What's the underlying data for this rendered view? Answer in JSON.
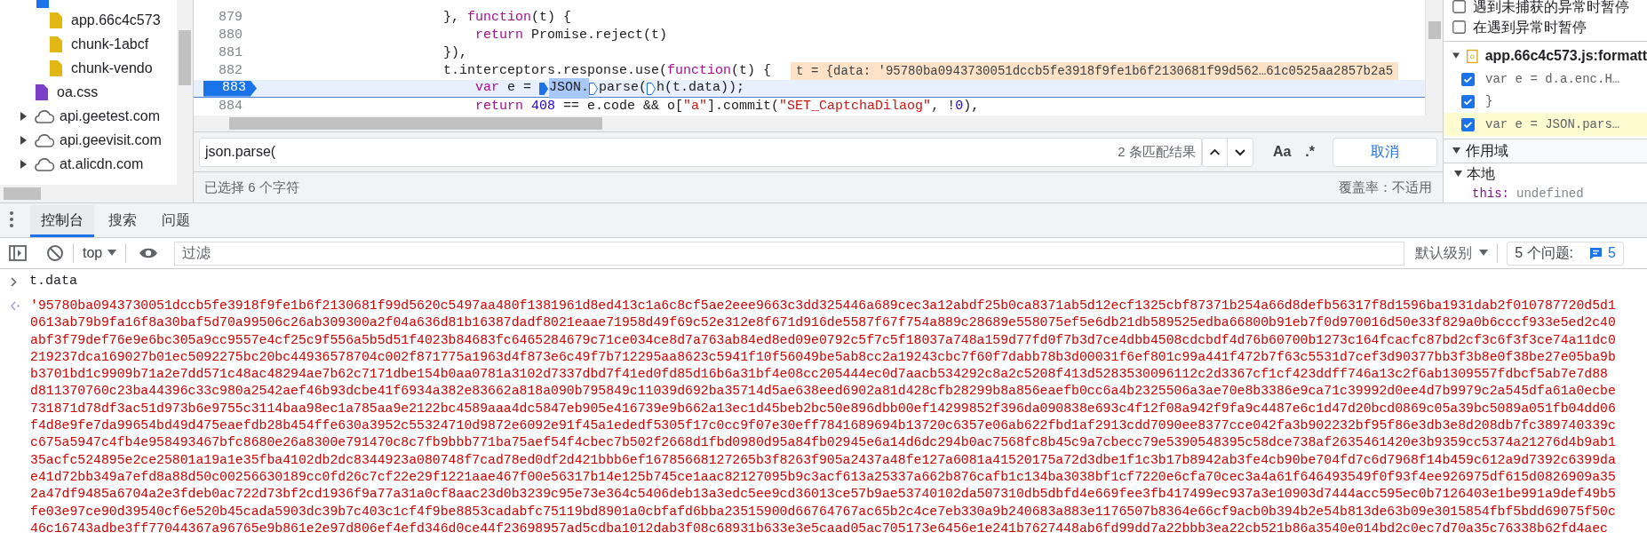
{
  "sources": {
    "nested_items": [
      {
        "kind": "folder",
        "children": [
          {
            "kind": "script",
            "label": "app.66c4c573"
          },
          {
            "kind": "script",
            "label": "chunk-1abcf"
          },
          {
            "kind": "script",
            "label": "chunk-vendo"
          }
        ]
      },
      {
        "kind": "stylesheet",
        "label": "oa.css"
      }
    ],
    "domains": [
      {
        "label": "api.geetest.com",
        "expanded": false
      },
      {
        "label": "api.geevisit.com",
        "expanded": false
      },
      {
        "label": "at.alicdn.com",
        "expanded": false
      }
    ]
  },
  "editor": {
    "lines": [
      {
        "number": "879",
        "paused": false,
        "tokens": [
          {
            "kind": "plain",
            "text": "}, "
          },
          {
            "kind": "keyword",
            "text": "function"
          },
          {
            "kind": "plain",
            "text": "(t) {"
          }
        ]
      },
      {
        "number": "880",
        "paused": false,
        "indent": true,
        "tokens": [
          {
            "kind": "keyword",
            "text": "return"
          },
          {
            "kind": "plain",
            "text": " Promise.reject(t)"
          }
        ]
      },
      {
        "number": "881",
        "paused": false,
        "tokens": [
          {
            "kind": "plain",
            "text": "}),"
          }
        ]
      },
      {
        "number": "882",
        "paused": false,
        "tokens": [
          {
            "kind": "plain",
            "text": "t.interceptors.response.use("
          },
          {
            "kind": "keyword",
            "text": "function"
          },
          {
            "kind": "plain",
            "text": "(t) {"
          }
        ],
        "inline_value": "t = {data: '95780ba0943730051dccb5fe3918f9fe1b6f2130681f99d562…61c0525aa2857b2a5"
      },
      {
        "number": "883",
        "paused": true,
        "indent": true,
        "tokens": [
          {
            "kind": "keyword",
            "text": "var"
          },
          {
            "kind": "plain",
            "text": " e = "
          },
          {
            "kind": "marker",
            "active": true
          },
          {
            "kind": "selected",
            "text": "JSON."
          },
          {
            "kind": "marker",
            "active": false
          },
          {
            "kind": "plain",
            "text": "parse("
          },
          {
            "kind": "marker",
            "active": false
          },
          {
            "kind": "plain",
            "text": "h(t.data));"
          }
        ]
      },
      {
        "number": "884",
        "paused": false,
        "indent": true,
        "tokens": [
          {
            "kind": "keyword",
            "text": "return"
          },
          {
            "kind": "number",
            "text": " 408"
          },
          {
            "kind": "plain",
            "text": " == e.code && o["
          },
          {
            "kind": "string",
            "text": "\"a\""
          },
          {
            "kind": "plain",
            "text": "].commit("
          },
          {
            "kind": "string",
            "text": "\"SET_CaptchaDilaog\""
          },
          {
            "kind": "plain",
            "text": ", !"
          },
          {
            "kind": "number",
            "text": "0"
          },
          {
            "kind": "plain",
            "text": "),"
          }
        ]
      }
    ]
  },
  "search": {
    "value": "json.parse(",
    "match_count": "2 条匹配结果",
    "case_button": "Aa",
    "regex_button": ".*",
    "cancel_button": "取消"
  },
  "status": {
    "selection": "已选择 6 个字符",
    "coverage": "覆盖率：不适用"
  },
  "debugger": {
    "pause_options": [
      {
        "label": "遇到未捕获的异常时暂停",
        "checked": false
      },
      {
        "label": "在遇到异常时暂停",
        "checked": false
      }
    ],
    "breakpoint_file": "app.66c4c573.js:formatt",
    "breakpoints": [
      {
        "label": "var e = d.a.enc.H…",
        "checked": true,
        "selected": false
      },
      {
        "label": "}",
        "checked": true,
        "selected": false
      },
      {
        "label": "var e = JSON.pars…",
        "checked": true,
        "selected": true
      }
    ],
    "scope": {
      "title": "作用域",
      "expanded": true,
      "sections": [
        {
          "title": "本地",
          "expanded": true,
          "vars": [
            {
              "name": "this:",
              "value": "undefined"
            }
          ]
        }
      ]
    }
  },
  "drawer": {
    "tabs": [
      {
        "label": "控制台",
        "selected": true
      },
      {
        "label": "搜索",
        "selected": false
      },
      {
        "label": "问题",
        "selected": false
      }
    ]
  },
  "console_toolbar": {
    "context": "top",
    "filter_placeholder": "过滤",
    "level": "默认级别",
    "issues_label": "5 个问题:",
    "issues_count": "5"
  },
  "console": {
    "input": "t.data",
    "output_lines": [
      "'95780ba0943730051dccb5fe3918f9fe1b6f2130681f99d5620c5497aa480f1381961d8ed413c1a6c8cf5ae2eee9663c3dd325446a689cec3a12abdf25b0ca8371ab5d12ecf1325cbf87371b254a66d8defb56317f8d1596ba1931dab2f010787720d5d1",
      "0613ab79b9fa16f8a30baf5d70a99506c26ab309300a2f04a636d81b16387dadf8021eaae71958d49f69c52e312e8f671d916de5587f67f754a889c28689e558075ef5e6db21db589525edba66800b91eb7f0d970016d50e33f829a0b6cccf933e5ed2c40",
      "abf3f79def76e9e6bc305a9cc9557e4cf25c9f556a5b5d51f4023b84683fc6465284679c71ce034ce8d7a763ab84ed8ed09e0792c5f7c5f18037a748a159d77fd0f7b3d7ce4dbb4508cdcbdf4d76b60700b1273c164fcacfc87bd2cf3c6f3f3ce74a11dc0",
      "219237dca169027b01ec5092275bc20bc44936578704c002f871775a1963d4f873e6c49f7b712295aa8623c5941f10f56049be5ab8cc2a19243cbc7f60f7dabb78b3d00031f6ef801c99a441f472b7f63c5531d7cef3d90377bb3f3b8e0f38be27e05ba9b",
      "b3701bd1c9909b71a2e7dd571c48ac48294ae7b62c7171dbe154b0aa0781a3102d7337dbd7f41ed0fd85d16b6a31bf4e08cc205444ec0d7aacb534292c8a2c5208f413d5283530096112c2d3367cf1cf423ddff746a13c2f6ab1309557fdbcf5ab7e7d88",
      "d811370760c23ba44396c33c980a2542aef46b93dcbe41f6934a382e83662a818a090b795849c11039d692ba35714d5ae638eed6902a81d428cfb28299b8a856eaefb0cc6a4b2325506a3ae70e8b3386e9ca71c39992d0ee4d7b9979c2a545dfa61a0ecbe",
      "731871d78df3ac51d973b6e9755c3114baa98ec1a785aa9e2122bc4589aaa4dc5847eb905e416739e9b662a13ec1d45beb2bc50e896dbb00ef14299852f396da090838e693c4f12f08a942f9fa9c4487e6c1d47d20bcd0869c05a39bc5089a051fb04dd06",
      "f4d8e9fe7da99654bd49d475eaefdb28b454ffe630a3952c55324710d9872e6092e91f45a1ededf5305f17c0cc9f07e30eff7841689694b13720c6357e06ab622fbd1af2913cdd7090ee8377cce042fa3b902232bf95f86e3db3e8d208db7fc389740339c",
      "c675a5947c4fb4e958493467bfc8680e26a8300e791470c8c7fb9bbb771ba75aef54f4cbec7b502f2668d1fbd0980d95a84fb02945e6a14d6dc294b0ac7568fc8b45c9a7cbecc79e5390548395c58dce738af2635461420e3b9359cc5374a21276d4b9ab1",
      "35acfc524895e2ce25801a19a1e35fba4102db2dc8344923a080748f7cad78ed0df2d421bbb6ef16785668127265b3f8263f905a2437a48fe127a6081a41520175a72d3dbe1f1c3b17b8942ab3fe4cb90be704fd7c6d7968f14b459c612a9d7392c6399da",
      "e41d72bb349a7efd8a88d50c00256630189cc0fd26c7cf22e29f1221aae467f00e56317b14e125b745ce1aac82127095b9c3acf613a25337a662b876cafb1c134ba3038bf1cf7220e6cfa70cec3a4a61f646493549f0f93f4ee926975df615d0826909a35",
      "2a47df9485a6704a2e3fdeb0ac722d73bf2cd1936f9a77a31a0cf8aac23d0b3239c95e73e364c5406deb13a3edc5ee9cd36013ce57b9ae53740102da507310db5dbfd4e669fee3fb417499ec937a3e10903d7444acc595ec0b7126403e1be991a9def49b5",
      "fe03e97ce90d39540cf6e520b45cada5903dc39b7c403c1cf4f9be8853cadabfc75119bd8901a0cbfafd6bba23515900d66764767ac65b2c4ce7eb330a9b240683a883e1176507b8364e66cf9acb0b394b2e54b813de63b09e3015854fbf5bdd69075f50c",
      "46c16743adbe3ff77044367a96765e9b861e2e97d806ef4efd346d0ce44f23698957ad5cdba1012dab3f08c68931b633e3e5caad05ac705173e6456e1e241b7627448ab6fd99dd7a22bbb3ea22cb521b86a3540e014bd2c0ec7d70a35c76338b62fd4aec"
    ]
  }
}
